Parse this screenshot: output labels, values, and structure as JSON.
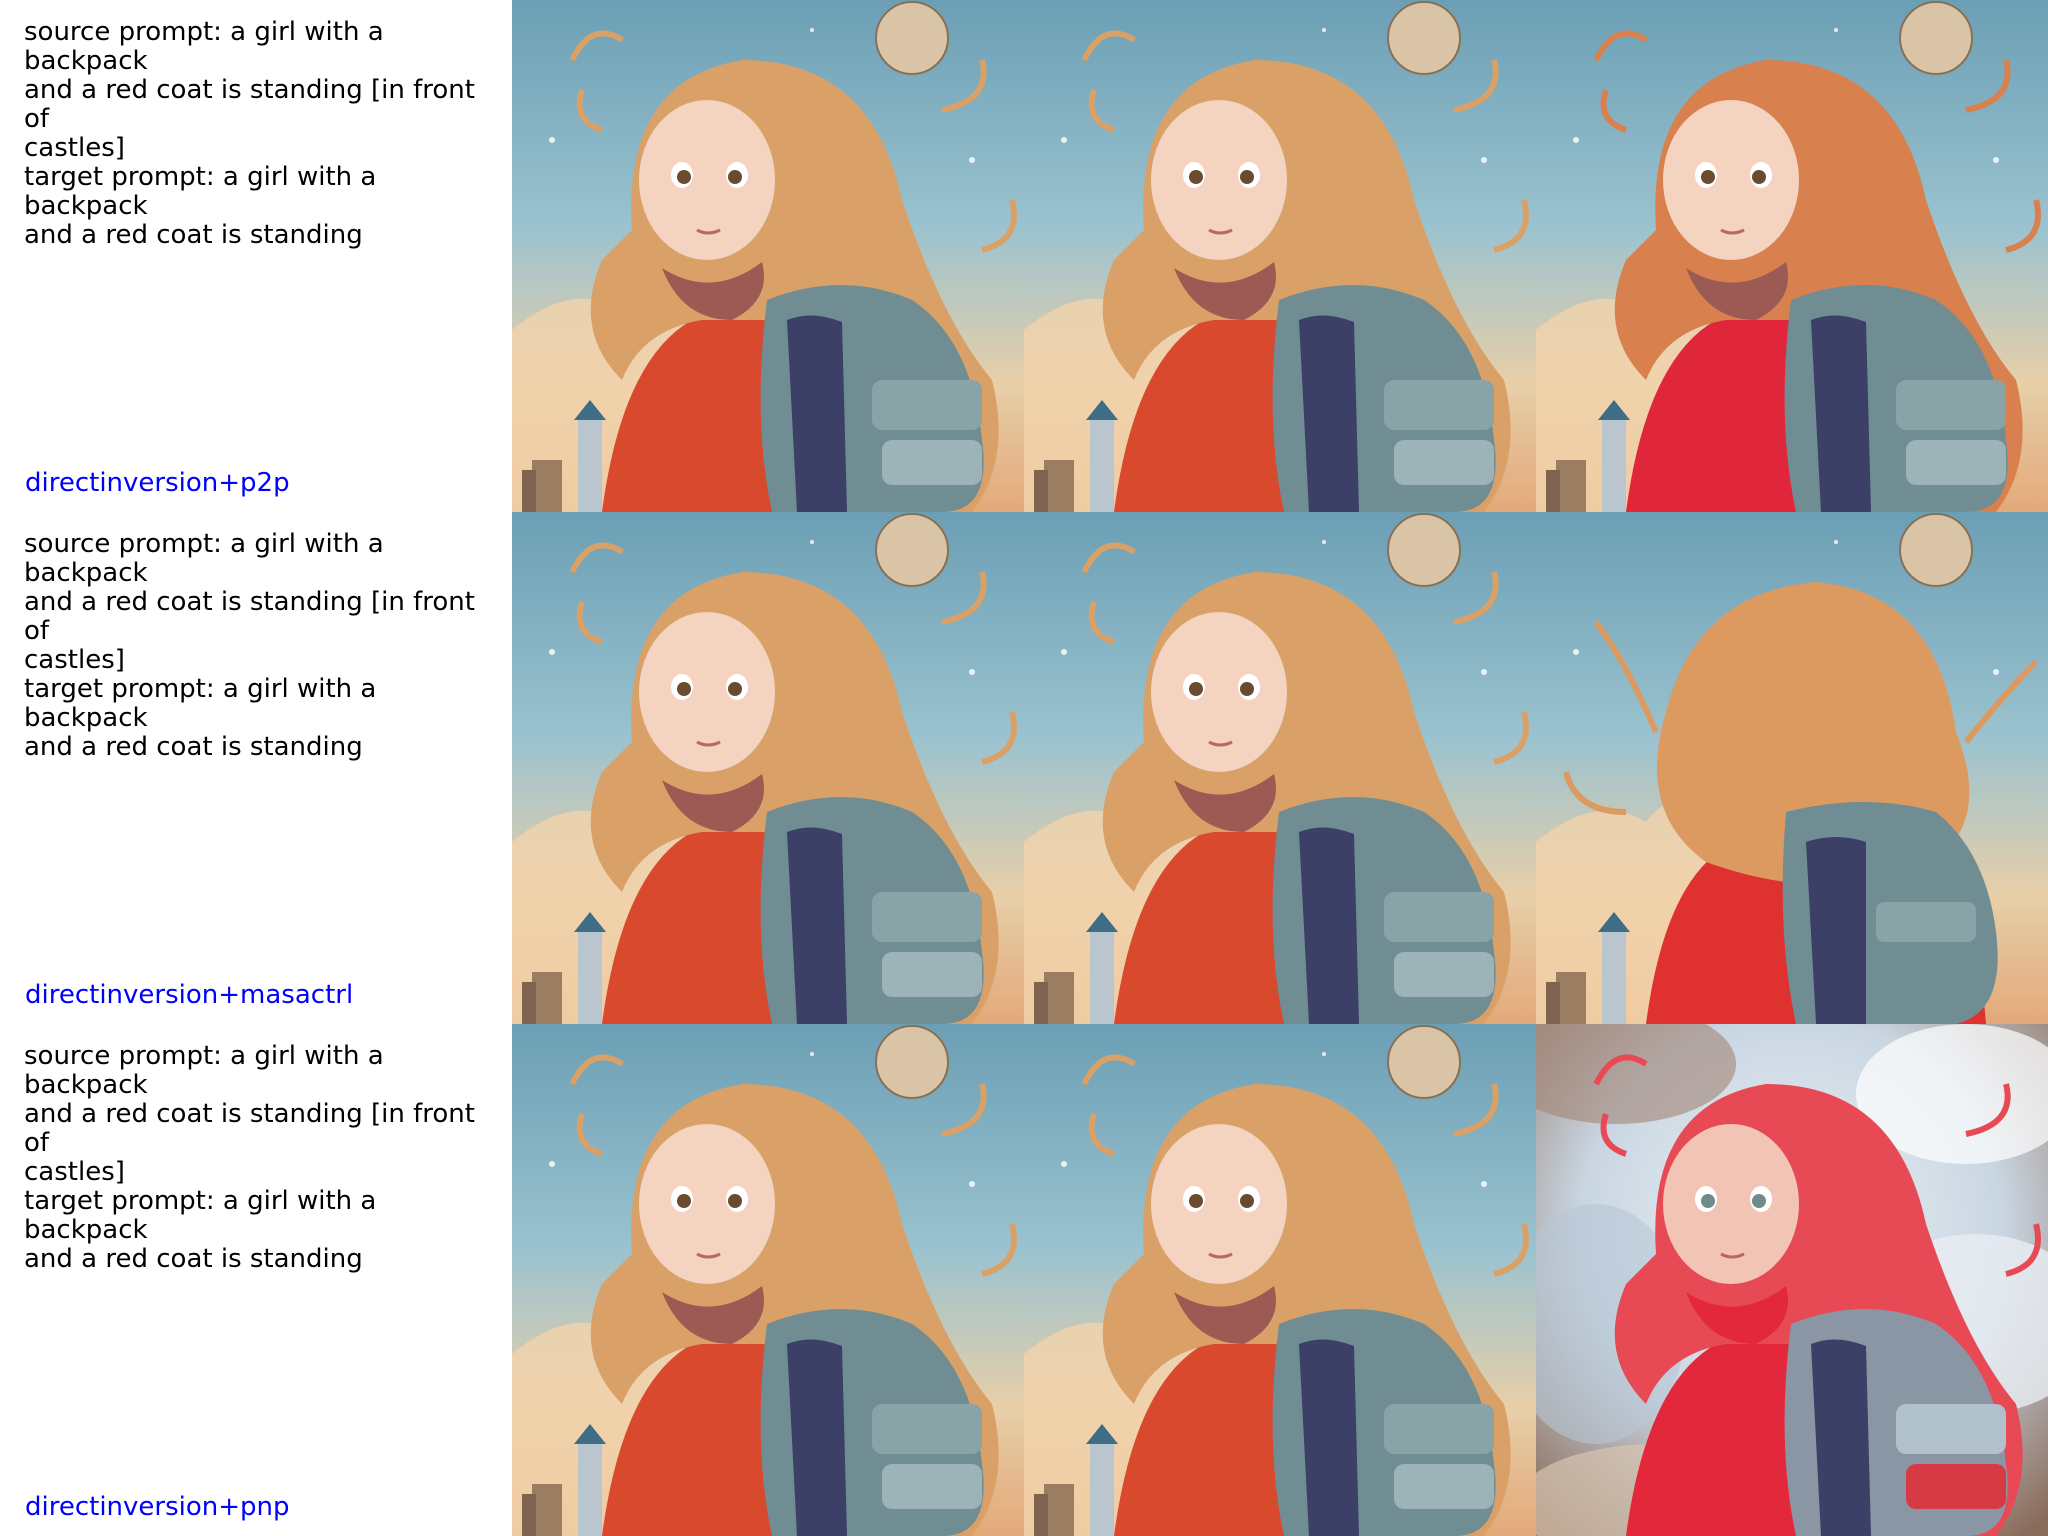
{
  "rows": [
    {
      "source_prompt": "source prompt: a girl with a backpack and a red coat is standing [in front of castles]",
      "source_prompt_lines": [
        "source prompt: a girl with a backpack",
        "and a red coat is standing [in front of",
        "castles]"
      ],
      "target_prompt_lines": [
        "target prompt: a girl with a backpack",
        "and a red coat is standing"
      ],
      "method": "directinversion+p2p"
    },
    {
      "source_prompt_lines": [
        "source prompt: a girl with a backpack",
        "and a red coat is standing [in front of",
        "castles]"
      ],
      "target_prompt_lines": [
        "target prompt: a girl with a backpack",
        "and a red coat is standing"
      ],
      "method": "directinversion+masactrl"
    },
    {
      "source_prompt_lines": [
        "source prompt: a girl with a backpack",
        "and a red coat is standing [in front of",
        "castles]"
      ],
      "target_prompt_lines": [
        "target prompt: a girl with a backpack",
        "and a red coat is standing"
      ],
      "method": "directinversion+pnp"
    }
  ],
  "colors": {
    "method_label": "#0000ff",
    "prompt_text": "#000000"
  }
}
